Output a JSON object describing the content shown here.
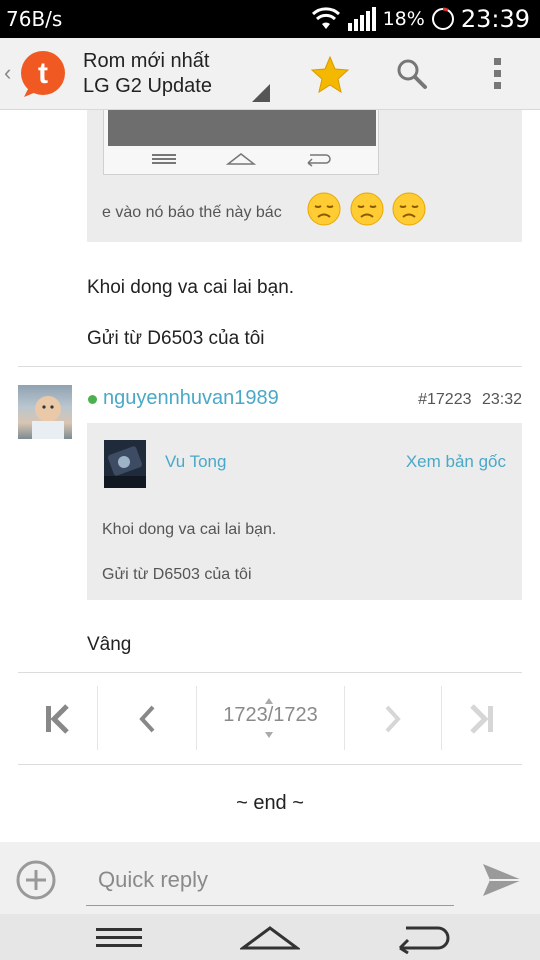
{
  "status_bar": {
    "net_speed": "76B/s",
    "battery": "18%",
    "time": "23:39"
  },
  "app_bar": {
    "title_line1": "Rom mới nhất",
    "title_line2": "LG G2 Update",
    "logo_letter": "t",
    "colors": {
      "logo": "#f05a22",
      "star": "#f5b800"
    }
  },
  "thread": {
    "quote1_text": "e vào nó báo thế này bác",
    "reply1_line1": "Khoi dong va cai lai bạn.",
    "reply1_line2": "Gửi từ D6503 của tôi",
    "post": {
      "username": "nguyennhuvan1989",
      "post_number": "#17223",
      "time": "23:32",
      "quote": {
        "user": "Vu Tong",
        "view_original": "Xem bản gốc",
        "line1": "Khoi dong va cai lai bạn.",
        "line2": "Gửi từ D6503 của tôi"
      },
      "body": "Vâng"
    }
  },
  "pager": {
    "current": "1723",
    "total": "1723",
    "end_label": "~ end ~"
  },
  "quick_reply": {
    "placeholder": "Quick reply"
  }
}
